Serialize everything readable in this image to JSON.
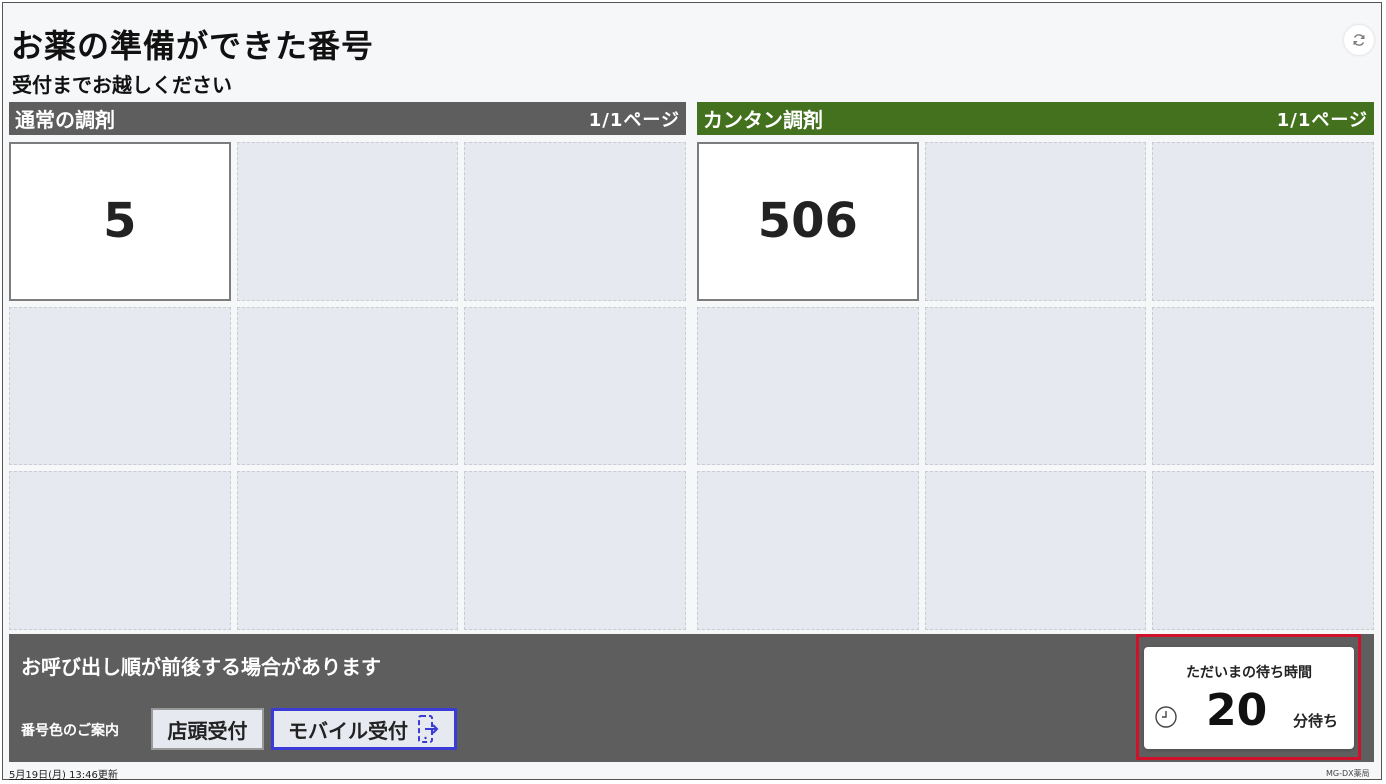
{
  "header": {
    "title": "お薬の準備ができた番号",
    "subtitle": "受付までお越しください"
  },
  "panels": [
    {
      "name": "通常の調剤",
      "page": "1/1ページ",
      "color": "#5e5e5e",
      "numbers": [
        "5"
      ]
    },
    {
      "name": "カンタン調剤",
      "page": "1/1ページ",
      "color": "#43711e",
      "numbers": [
        "506"
      ]
    }
  ],
  "footer": {
    "notice": "お呼び出し順が前後する場合があります",
    "guide_label": "番号色のご案内",
    "store_label": "店頭受付",
    "mobile_label": "モバイル受付"
  },
  "wait": {
    "title": "ただいまの待ち時間",
    "minutes": "20",
    "unit": "分待ち"
  },
  "status": {
    "updated": "5月19日(月) 13:46更新",
    "brand": "MG-DX薬局"
  },
  "icons": {
    "refresh": "refresh-icon",
    "clock": "clock-icon",
    "mobile": "mobile-exit-icon"
  },
  "colors": {
    "highlight": "#d0112a",
    "mobile_border": "#3b3bd6"
  }
}
